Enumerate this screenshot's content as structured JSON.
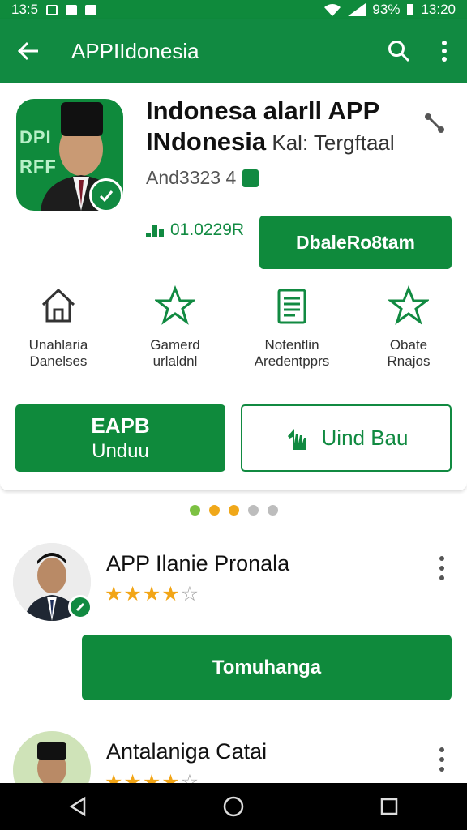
{
  "status_bar": {
    "time_left": "13:5",
    "battery": "93%",
    "time_right": "13:20"
  },
  "app_bar": {
    "title": "APPIIdonesia",
    "back_icon": "arrow-left-icon",
    "search_icon": "search-icon",
    "more_icon": "more-vert-icon"
  },
  "app": {
    "title_line1": "Indonesa alarll APP",
    "title_line2": "INdonesia",
    "title_line2_sub": " Kal: Tergftaal",
    "icon_text": "DPI\nRFF",
    "version": "And3323 4",
    "downloads": "01.0229R",
    "primary_button": "DbaleRo8tam"
  },
  "features": [
    {
      "icon": "house-icon",
      "label": "Unahlaria\nDanelses"
    },
    {
      "icon": "star-outline-icon",
      "label": "Gamerd\nurlaldnl"
    },
    {
      "icon": "document-icon",
      "label": "Notentlin\nAredentpprs"
    },
    {
      "icon": "star-outline-icon",
      "label": "Obate\nRnajos"
    }
  ],
  "actions": {
    "solid_line1": "EAPB",
    "solid_line2": "Unduu",
    "outline_label": "Uind Bau",
    "outline_icon": "hand-pointer-icon"
  },
  "pager": {
    "count": 5,
    "colors": [
      "#7cc142",
      "#f0a81a",
      "#f0a81a",
      "#bdbdbd",
      "#bdbdbd"
    ]
  },
  "list": [
    {
      "title": "APP Ilanie Pronala",
      "rating": 4,
      "rating_max": 5
    },
    {
      "title": "Antalaniga Catai",
      "rating": 4,
      "rating_max": 5
    }
  ],
  "list_button": "Tomuhanga",
  "nav": {
    "back": "back-triangle-icon",
    "home": "home-circle-icon",
    "recents": "recents-square-icon"
  },
  "colors": {
    "primary": "#0f8a3c",
    "star": "#f2a516"
  }
}
